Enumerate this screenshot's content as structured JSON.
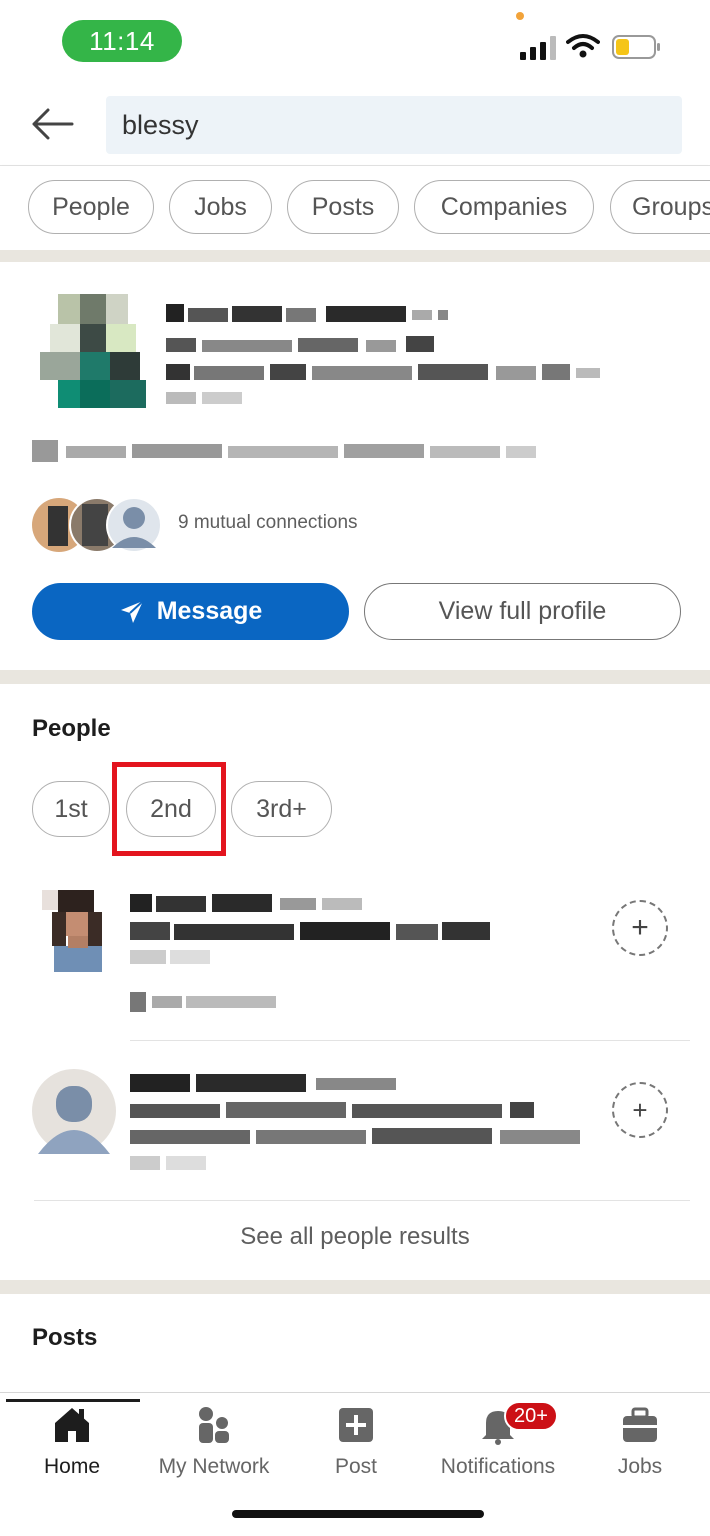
{
  "status": {
    "time": "11:14"
  },
  "search": {
    "query": "blessy"
  },
  "filters": [
    "People",
    "Jobs",
    "Posts",
    "Companies",
    "Groups"
  ],
  "top_result": {
    "mutual": "9 mutual connections",
    "message_label": "Message",
    "view_profile_label": "View full profile"
  },
  "people": {
    "title": "People",
    "degree_filters": [
      "1st",
      "2nd",
      "3rd+"
    ],
    "highlighted_filter": "2nd",
    "see_all": "See all people results"
  },
  "posts": {
    "title": "Posts"
  },
  "nav": {
    "items": [
      "Home",
      "My Network",
      "Post",
      "Notifications",
      "Jobs"
    ],
    "active": "Home",
    "notifications_badge": "20+"
  },
  "colors": {
    "brand_blue": "#0a66c2",
    "status_green": "#34b548",
    "highlight_red": "#e3141e",
    "badge_red": "#cc1016"
  }
}
